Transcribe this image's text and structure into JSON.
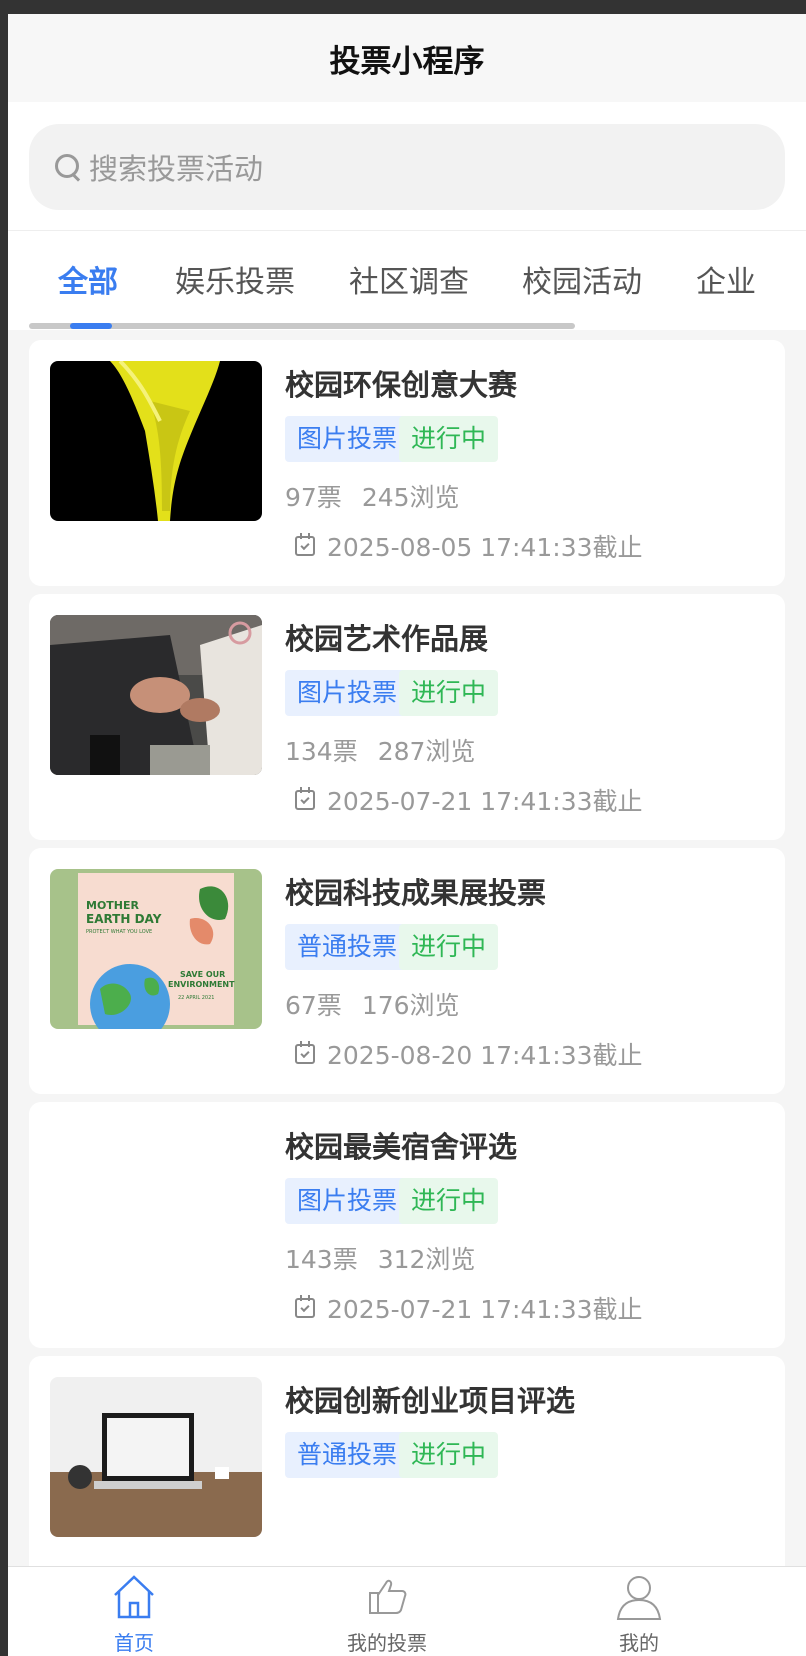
{
  "navbar": {
    "title": "投票小程序"
  },
  "search": {
    "placeholder": "搜索投票活动"
  },
  "tabs": [
    {
      "label": "全部",
      "active": true
    },
    {
      "label": "娱乐投票"
    },
    {
      "label": "社区调查"
    },
    {
      "label": "校园活动"
    },
    {
      "label": "企业"
    }
  ],
  "cards": [
    {
      "title": "校园环保创意大赛",
      "type_tag": "图片投票",
      "status_tag": "进行中",
      "votes": "97票",
      "views": "245浏览",
      "deadline": "2025-08-05 17:41:33截止",
      "thumb": "yellow-calla-lily"
    },
    {
      "title": "校园艺术作品展",
      "type_tag": "图片投票",
      "status_tag": "进行中",
      "votes": "134票",
      "views": "287浏览",
      "deadline": "2025-07-21 17:41:33截止",
      "thumb": "business-meeting-hands"
    },
    {
      "title": "校园科技成果展投票",
      "type_tag": "普通投票",
      "status_tag": "进行中",
      "votes": "67票",
      "views": "176浏览",
      "deadline": "2025-08-20 17:41:33截止",
      "thumb": "earth-day-poster",
      "poster": {
        "line1": "MOTHER",
        "line2": "EARTH DAY",
        "line3": "PROTECT WHAT YOU LOVE",
        "line4": "SAVE OUR",
        "line5": "ENVIRONMENT",
        "line6": "22 APRIL 2021"
      }
    },
    {
      "title": "校园最美宿舍评选",
      "type_tag": "图片投票",
      "status_tag": "进行中",
      "votes": "143票",
      "views": "312浏览",
      "deadline": "2025-07-21 17:41:33截止",
      "thumb": "blank"
    },
    {
      "title": "校园创新创业项目评选",
      "type_tag": "普通投票",
      "status_tag": "进行中",
      "votes": "",
      "views": "",
      "deadline": "",
      "thumb": "laptop-on-desk"
    }
  ],
  "tabbar": [
    {
      "label": "首页",
      "icon": "home-icon",
      "active": true
    },
    {
      "label": "我的投票",
      "icon": "thumbs-up-icon"
    },
    {
      "label": "我的",
      "icon": "user-icon"
    }
  ],
  "colors": {
    "accent": "#3a7df0",
    "status_green": "#2fb755",
    "tag_blue_bg": "#e8f0fe",
    "tag_green_bg": "#e8f8ec"
  }
}
